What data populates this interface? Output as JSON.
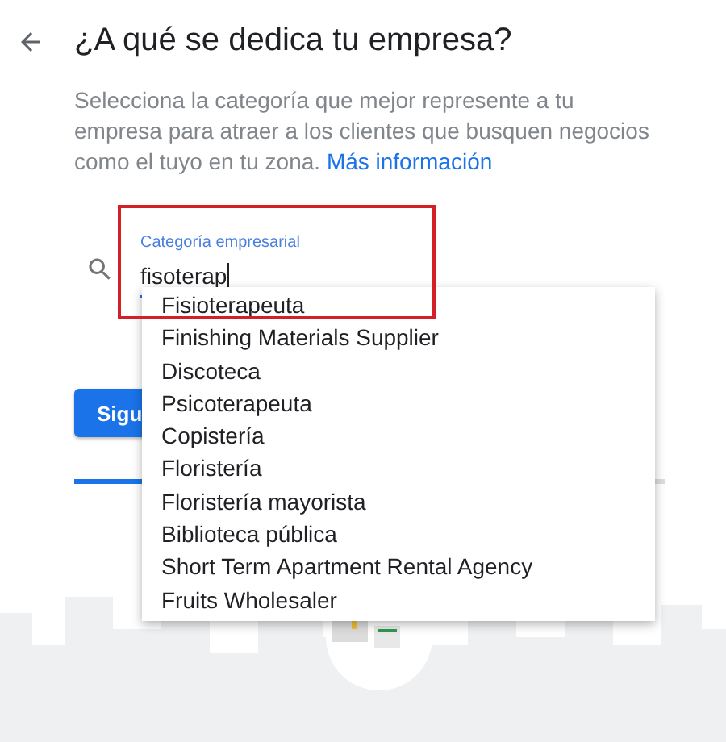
{
  "header": {
    "title": "¿A qué se dedica tu empresa?"
  },
  "description": {
    "text": "Selecciona la categoría que mejor represente a tu empresa para atraer a los clientes que busquen negocios como el tuyo en tu zona.",
    "link": "Más información"
  },
  "category_field": {
    "label": "Categoría empresarial",
    "value": "fisoterap",
    "focused": true
  },
  "suggestions": [
    {
      "label": "Fisioterapeuta"
    },
    {
      "label": "Finishing Materials Supplier"
    },
    {
      "label": "Discoteca"
    },
    {
      "label": "Psicoterapeuta"
    },
    {
      "label": "Copistería"
    },
    {
      "label": "Floristería"
    },
    {
      "label": "Floristería mayorista"
    },
    {
      "label": "Biblioteca pública"
    },
    {
      "label": "Short Term Apartment Rental Agency"
    },
    {
      "label": "Fruits Wholesaler"
    }
  ],
  "next_button": {
    "label": "Sigu"
  },
  "progress": {
    "level": 0.115
  },
  "annotation": {
    "kind": "highlight",
    "color": "#d32027"
  }
}
